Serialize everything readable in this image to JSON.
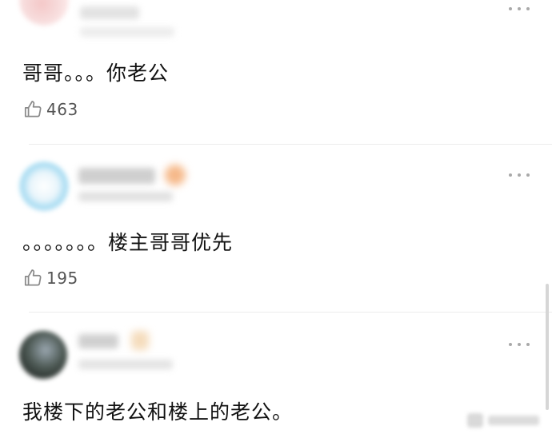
{
  "comments": [
    {
      "text": "哥哥。。。你老公",
      "likes": "463"
    },
    {
      "text": "。。。。。。。楼主哥哥优先",
      "likes": "195"
    },
    {
      "text": "我楼下的老公和楼上的老公。"
    }
  ],
  "icons": {
    "like": "thumbs-up-icon",
    "more": "more-dots-icon"
  },
  "colors": {
    "text": "#111111",
    "like_count": "#555555",
    "icon": "#8a8a8a",
    "divider": "#ececec"
  }
}
